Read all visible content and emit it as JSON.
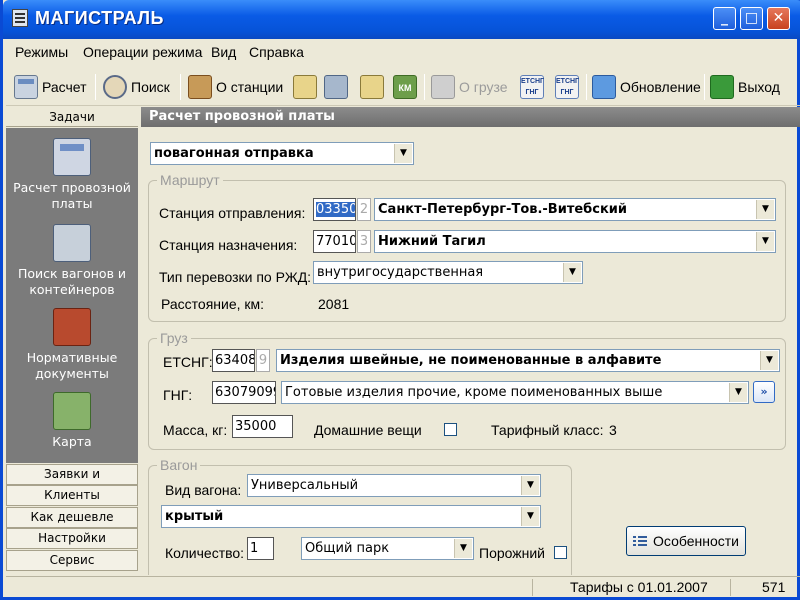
{
  "window": {
    "title": "МАГИСТРАЛЬ",
    "controls": [
      "_",
      "□",
      "✕"
    ]
  },
  "menu": [
    "Режимы",
    "Операции режима",
    "Вид",
    "Справка"
  ],
  "toolbar": {
    "calc": "Расчет",
    "search": "Поиск",
    "station": "О станции",
    "cargo": "О грузе",
    "codes1": "ЕТСНГ ГНГ",
    "codes2": "ЕТСНГ ГНГ",
    "update": "Обновление",
    "exit": "Выход",
    "km_icon": "КМ"
  },
  "sidebar": {
    "header": "Задачи",
    "tasks": [
      {
        "label": "Расчет провозной платы",
        "icon": "calculator-icon"
      },
      {
        "label": "Поиск вагонов и контейнеров",
        "icon": "wagon-search-icon"
      },
      {
        "label": "Нормативные документы",
        "icon": "book-icon"
      },
      {
        "label": "Карта",
        "icon": "map-icon"
      }
    ],
    "tabs": [
      "Заявки и накладные",
      "Клиенты",
      "Как дешевле",
      "Настройки",
      "Сервис"
    ]
  },
  "main": {
    "header": "Расчет провозной платы",
    "shipment_type": "повагонная отправка",
    "route": {
      "legend": "Маршрут",
      "from_label": "Станция отправления:",
      "from_code": "03350",
      "from_check": "2",
      "from_name": "Санкт-Петербург-Тов.-Витебский",
      "to_label": "Станция назначения:",
      "to_code": "77010",
      "to_check": "3",
      "to_name": "Нижний Тагил",
      "type_label": "Тип перевозки по РЖД:",
      "type_value": "внутригосударственная",
      "distance_label": "Расстояние, км:",
      "distance_value": "2081"
    },
    "cargo": {
      "legend": "Груз",
      "etsng_label": "ЕТСНГ:",
      "etsng_code": "63408",
      "etsng_check": "9",
      "etsng_name": "Изделия швейные, не поименованные в алфавите",
      "gng_label": "ГНГ:",
      "gng_code": "63079099",
      "gng_name": "Готовые изделия прочие, кроме поименованных выше",
      "gng_button": "»",
      "mass_label": "Масса, кг:",
      "mass_value": "35000",
      "household_label": "Домашние вещи",
      "tariff_class_label": "Тарифный класс:",
      "tariff_class_value": "3"
    },
    "wagon": {
      "legend": "Вагон",
      "kind_label": "Вид вагона:",
      "kind_value": "Универсальный",
      "subkind_value": "крытый",
      "count_label": "Количество:",
      "count_value": "1",
      "park_value": "Общий парк",
      "empty_label": "Порожний"
    },
    "features_button": "Особенности"
  },
  "status": {
    "tariffs": "Тарифы  с 01.01.2007",
    "number": "571"
  }
}
